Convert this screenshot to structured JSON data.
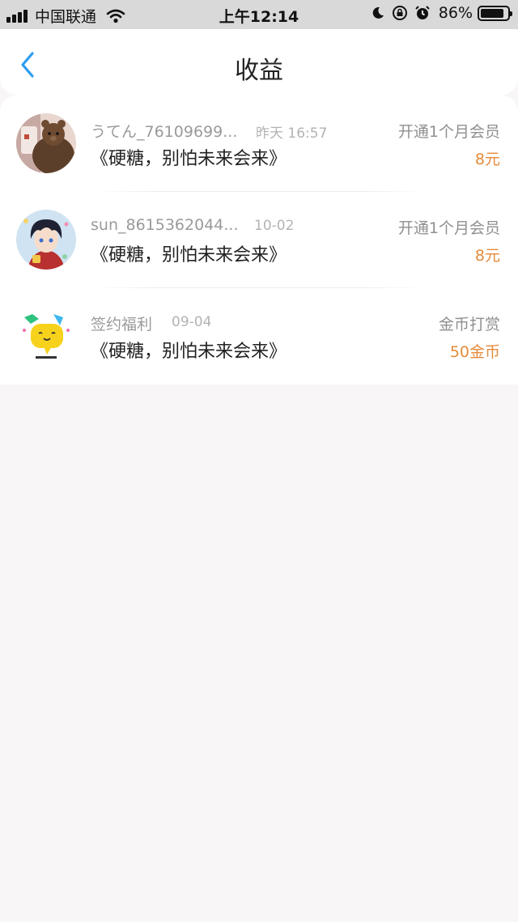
{
  "status_bar": {
    "carrier": "中国联通",
    "time": "上午12:14",
    "battery": "86%",
    "battery_level": 0.86,
    "icons": [
      "signal-icon",
      "wifi-icon",
      "moon-icon",
      "rotation-lock-icon",
      "alarm-icon",
      "battery-icon"
    ]
  },
  "nav": {
    "title": "收益",
    "back_icon": "chevron-left-icon",
    "accent": "#2d9cf0"
  },
  "colors": {
    "amount": "#e58b3a",
    "background": "#f8f6f7"
  },
  "items": [
    {
      "name": "うてん_76109699...",
      "time": "昨天 16:57",
      "book": "《硬糖，别怕未来会来》",
      "type": "开通1个月会员",
      "amount": "8元",
      "avatar": "bear-avatar"
    },
    {
      "name": "sun_8615362044...",
      "time": "10-02",
      "book": "《硬糖，别怕未来会来》",
      "type": "开通1个月会员",
      "amount": "8元",
      "avatar": "anime-boy-avatar"
    },
    {
      "name": "签约福利",
      "time": "09-04",
      "book": "《硬糖，别怕未来会来》",
      "type": "金币打赏",
      "amount": "50金币",
      "avatar": "yellow-chat-bubble-avatar"
    }
  ]
}
